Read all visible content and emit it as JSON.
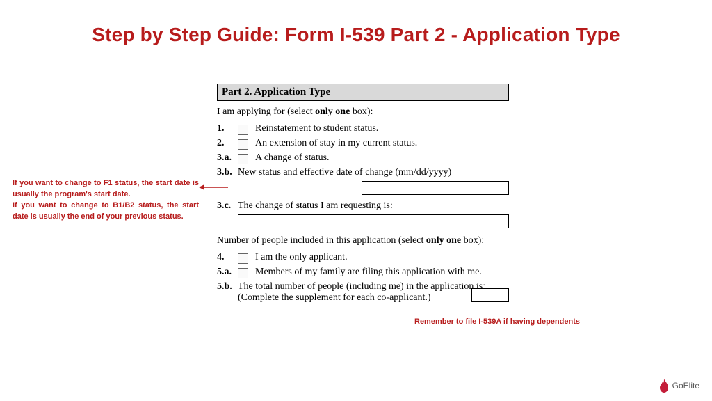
{
  "title": "Step by Step Guide: Form I-539 Part 2 - Application Type",
  "form": {
    "partHeader": "Part 2.  Application Type",
    "leadA": "I am applying for (select ",
    "leadBold": "only one",
    "leadB": " box):",
    "items": {
      "r1": {
        "num": "1.",
        "text": "Reinstatement to student status."
      },
      "r2": {
        "num": "2.",
        "text": "An extension of stay in my current status."
      },
      "r3a": {
        "num": "3.a.",
        "text": "A change of status."
      },
      "r3b": {
        "num": "3.b.",
        "text": "New status and effective date of change (mm/dd/yyyy)"
      },
      "r3c": {
        "num": "3.c.",
        "text": "The change of status I am requesting is:"
      },
      "sec2A": "Number of people included in this application (select ",
      "sec2Bold": "only one",
      "sec2B": " box):",
      "r4": {
        "num": "4.",
        "text": "I am the only applicant."
      },
      "r5a": {
        "num": "5.a.",
        "text": "Members of my family are filing this application with me."
      },
      "r5b": {
        "num": "5.b.",
        "text": "The total number of people (including me) in the application is: (Complete the supplement for each co-applicant.)"
      }
    }
  },
  "notes": {
    "leftA": "If you want to change to F1 status, the start date is usually the program's start date.",
    "leftB": "If you want to change to B1/B2 status, the start date is usually the end of your previous status.",
    "right": "Remember to file I-539A if having dependents"
  },
  "brand": "GoElite"
}
